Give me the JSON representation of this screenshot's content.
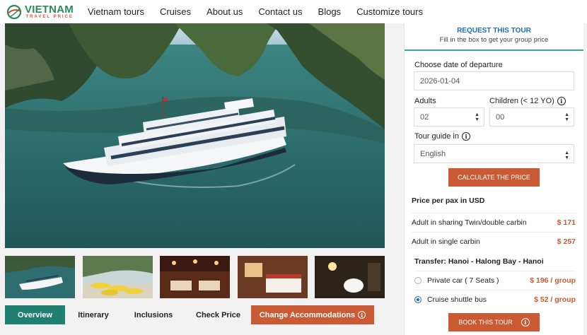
{
  "brand": {
    "name": "VIETNAM",
    "tagline": "TRAVEL PRICE"
  },
  "nav": [
    "Vietnam tours",
    "Cruises",
    "About us",
    "Contact us",
    "Blogs",
    "Customize tours"
  ],
  "tabs": {
    "overview": "Overview",
    "itinerary": "Itinerary",
    "inclusions": "Inclusions",
    "check_price": "Check Price",
    "change_accommodations": "Change Accommodations"
  },
  "panel": {
    "title": "REQUEST THIS TOUR",
    "subtitle": "Fill in the box to get your group price",
    "departure_label": "Choose date of departure",
    "departure_value": "2026-01-04",
    "adults_label": "Adults",
    "adults_value": "02",
    "children_label": "Children (< 12 YO)",
    "children_value": "00",
    "guide_label": "Tour guide in",
    "guide_value": "English",
    "calc_button": "CALCULATE THE PRICE",
    "price_title": "Price per pax in USD",
    "prices": [
      {
        "label": "Adult in sharing Twin/double carbin",
        "value": "$ 171"
      },
      {
        "label": "Adult in single carbin",
        "value": "$ 257"
      }
    ],
    "transfer_title": "Transfer: Hanoi - Halong Bay - Hanoi",
    "transfers": [
      {
        "label": "Private car ( 7 Seats )",
        "value": "$ 196 / group",
        "checked": false
      },
      {
        "label": "Cruise shuttle bus",
        "value": "$ 52 / group",
        "checked": true
      }
    ],
    "book_button": "BOOK THIS TOUR"
  },
  "colors": {
    "brand_green": "#2a8a5a",
    "accent": "#c95a33",
    "tab_active": "#1f7f71",
    "link_blue": "#1f6fb4"
  }
}
